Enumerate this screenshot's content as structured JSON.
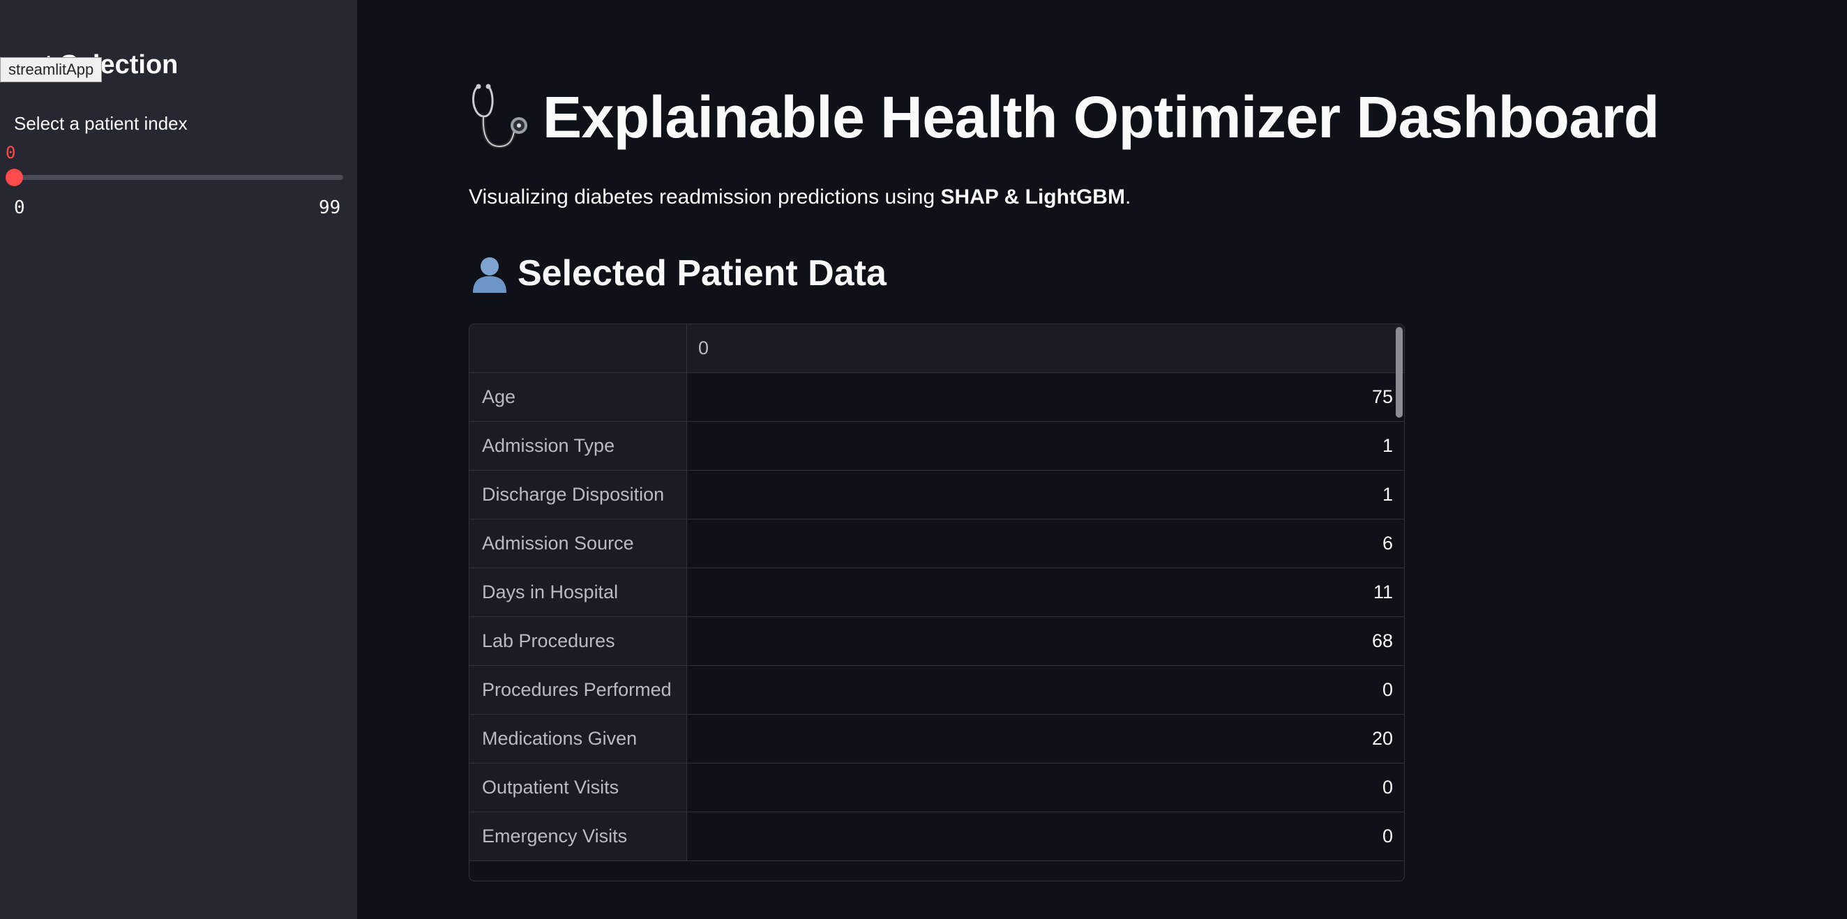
{
  "tooltip": {
    "text": "streamlitApp"
  },
  "sidebar": {
    "title": "nt Selection",
    "slider": {
      "label": "Select a patient index",
      "value": "0",
      "min": "0",
      "max": "99",
      "fill_fraction": 0
    }
  },
  "main": {
    "title": "Explainable Health Optimizer Dashboard",
    "title_icon": "stethoscope-icon",
    "subtitle": {
      "prefix": "Visualizing diabetes readmission predictions using ",
      "bold": "SHAP & LightGBM",
      "suffix": "."
    },
    "section_title": "Selected Patient Data",
    "section_icon": "person-icon"
  },
  "table": {
    "column_header": "0",
    "rows": [
      {
        "label": "Age",
        "value": "75"
      },
      {
        "label": "Admission Type",
        "value": "1"
      },
      {
        "label": "Discharge Disposition",
        "value": "1"
      },
      {
        "label": "Admission Source",
        "value": "6"
      },
      {
        "label": "Days in Hospital",
        "value": "11"
      },
      {
        "label": "Lab Procedures",
        "value": "68"
      },
      {
        "label": "Procedures Performed",
        "value": "0"
      },
      {
        "label": "Medications Given",
        "value": "20"
      },
      {
        "label": "Outpatient Visits",
        "value": "0"
      },
      {
        "label": "Emergency Visits",
        "value": "0"
      }
    ]
  },
  "colors": {
    "background": "#0e1117",
    "sidebar": "#262730",
    "accent": "#ff4b4b",
    "text": "#fafafa"
  }
}
